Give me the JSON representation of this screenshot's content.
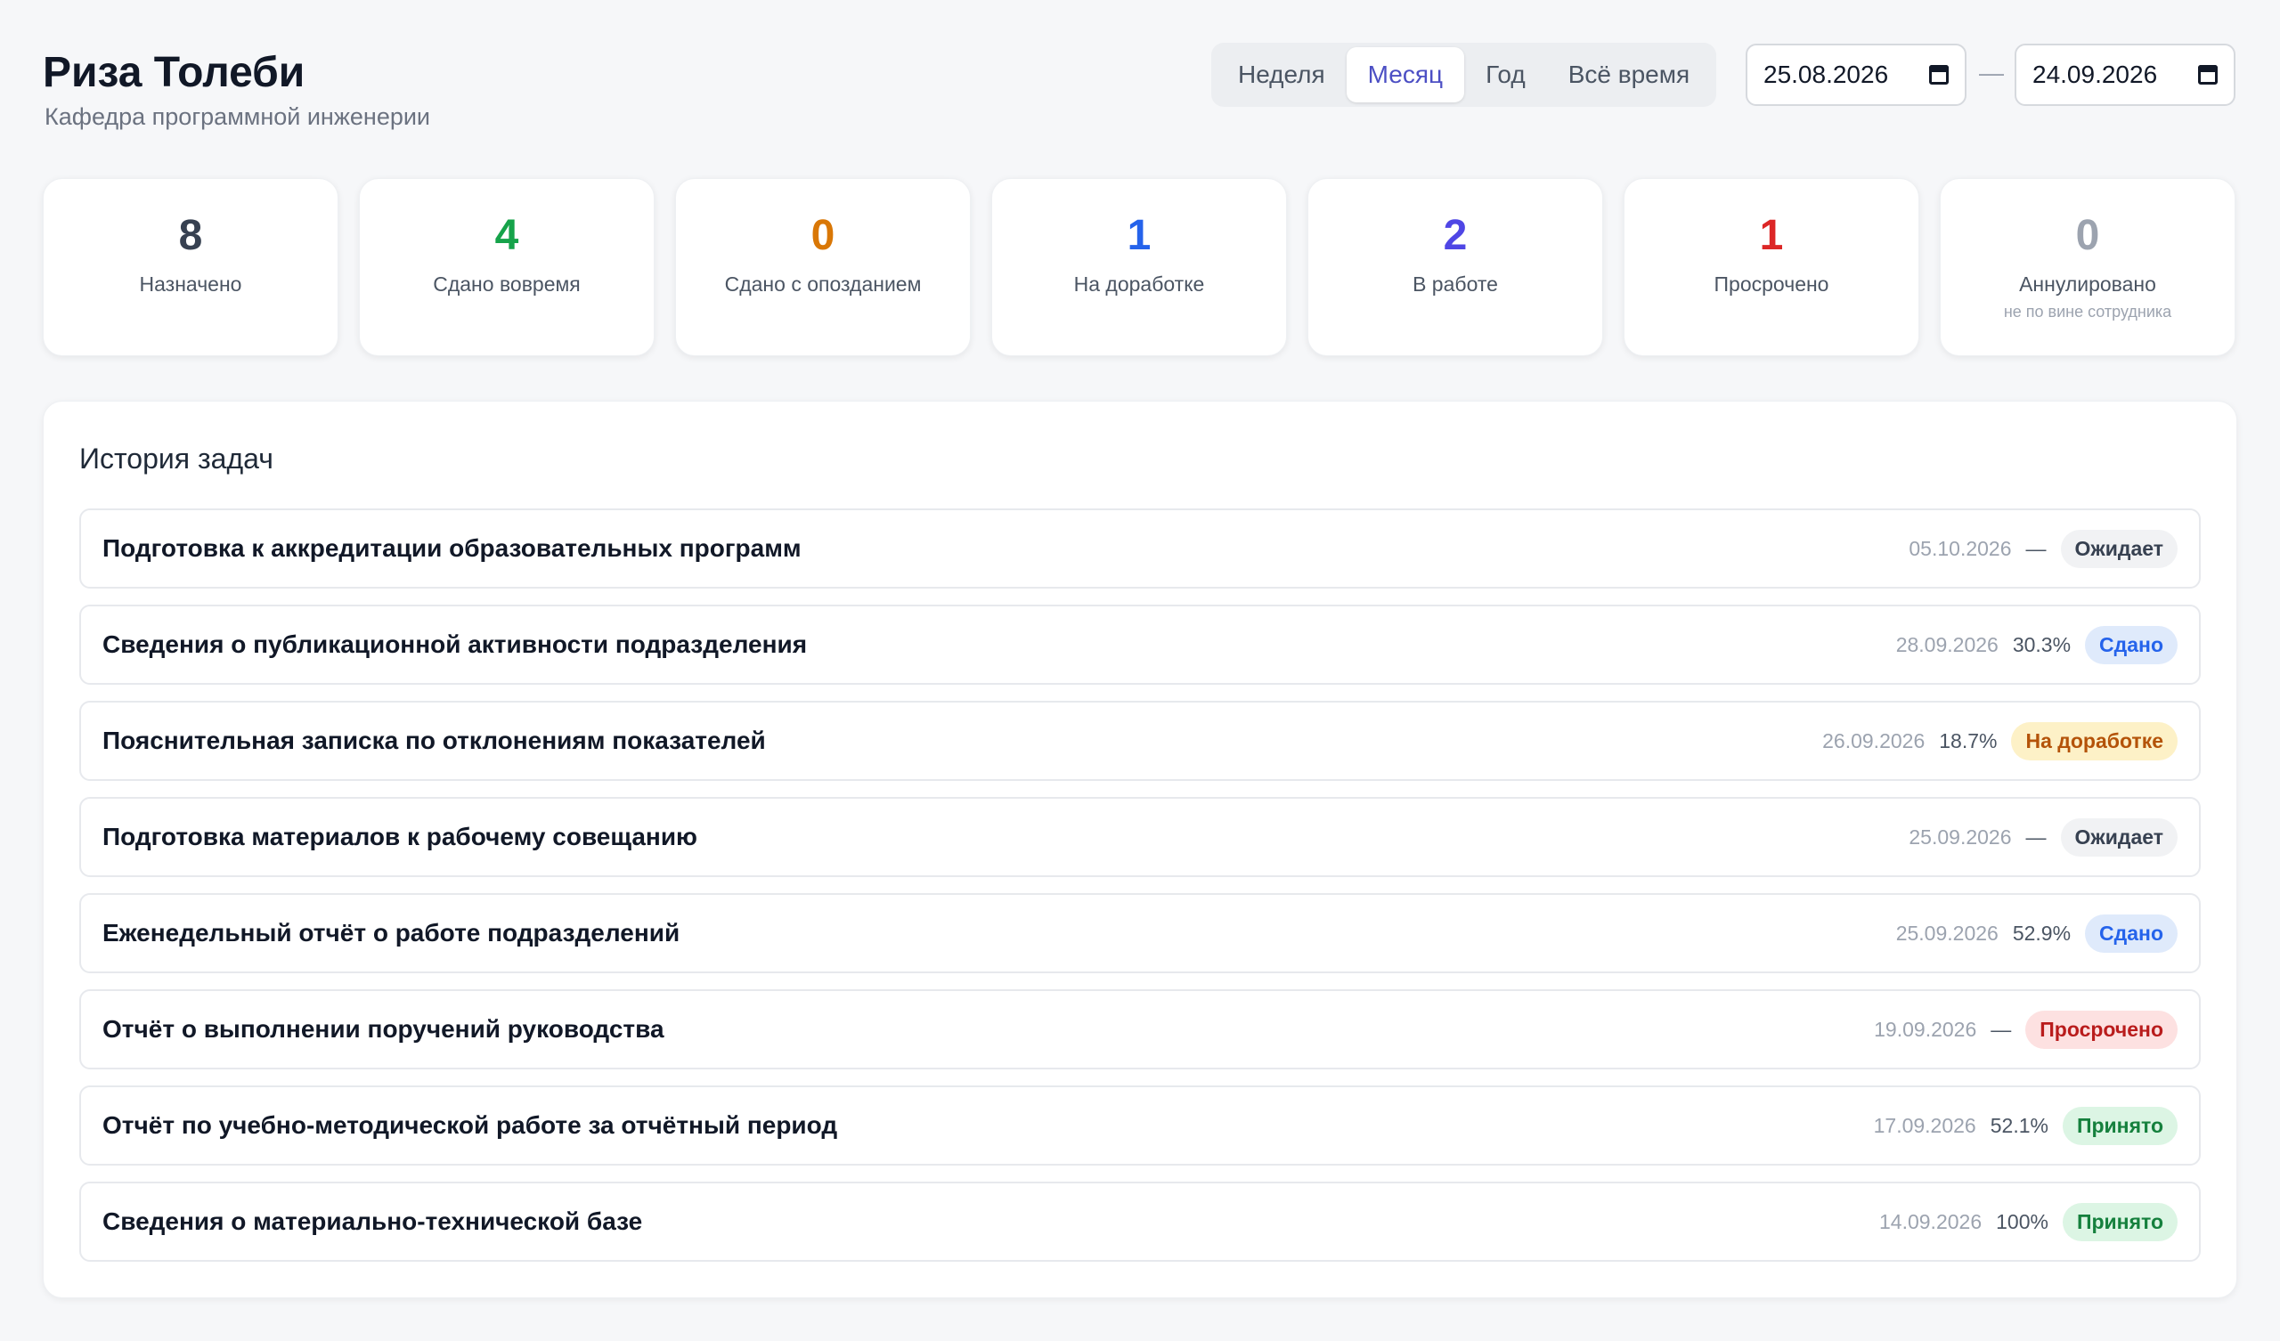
{
  "header": {
    "name": "Риза Толеби",
    "department": "Кафедра программной инженерии"
  },
  "period": {
    "options": [
      "Неделя",
      "Месяц",
      "Год",
      "Всё время"
    ],
    "selected": "Месяц"
  },
  "date_range": {
    "from": "25.08.2026",
    "separator": "—",
    "to": "24.09.2026"
  },
  "stats": [
    {
      "value": "8",
      "label": "Назначено",
      "color": "#374151"
    },
    {
      "value": "4",
      "label": "Сдано вовремя",
      "color": "#16a34a"
    },
    {
      "value": "0",
      "label": "Сдано с опозданием",
      "color": "#d97706"
    },
    {
      "value": "1",
      "label": "На доработке",
      "color": "#2563eb"
    },
    {
      "value": "2",
      "label": "В работе",
      "color": "#4f46e5"
    },
    {
      "value": "1",
      "label": "Просрочено",
      "color": "#dc2626"
    },
    {
      "value": "0",
      "label": "Аннулировано",
      "note": "не по вине сотрудника",
      "color": "#9ca3af"
    }
  ],
  "history": {
    "title": "История задач",
    "tasks": [
      {
        "title": "Подготовка к аккредитации образовательных программ",
        "date": "05.10.2026",
        "percent": "—",
        "status": "Ожидает",
        "status_type": "waiting"
      },
      {
        "title": "Сведения о публикационной активности подразделения",
        "date": "28.09.2026",
        "percent": "30.3%",
        "status": "Сдано",
        "status_type": "submitted"
      },
      {
        "title": "Пояснительная записка по отклонениям показателей",
        "date": "26.09.2026",
        "percent": "18.7%",
        "status": "На доработке",
        "status_type": "rework"
      },
      {
        "title": "Подготовка материалов к рабочему совещанию",
        "date": "25.09.2026",
        "percent": "—",
        "status": "Ожидает",
        "status_type": "waiting"
      },
      {
        "title": "Еженедельный отчёт о работе подразделений",
        "date": "25.09.2026",
        "percent": "52.9%",
        "status": "Сдано",
        "status_type": "submitted"
      },
      {
        "title": "Отчёт о выполнении поручений руководства",
        "date": "19.09.2026",
        "percent": "—",
        "status": "Просрочено",
        "status_type": "overdue"
      },
      {
        "title": "Отчёт по учебно-методической работе за отчётный период",
        "date": "17.09.2026",
        "percent": "52.1%",
        "status": "Принято",
        "status_type": "accepted"
      },
      {
        "title": "Сведения о материально-технической базе",
        "date": "14.09.2026",
        "percent": "100%",
        "status": "Принято",
        "status_type": "accepted"
      }
    ]
  }
}
